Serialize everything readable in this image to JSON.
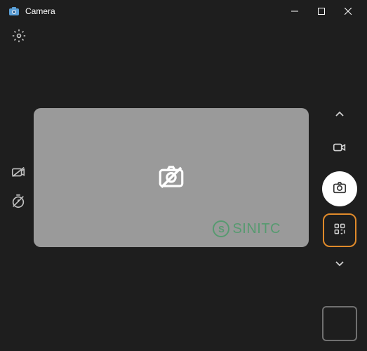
{
  "titlebar": {
    "app_name": "Camera"
  },
  "watermark": {
    "symbol": "S",
    "text": "SINITC"
  },
  "icons": {
    "settings": "gear",
    "no_camera": "no-camera",
    "switch_camera": "switch-camera-off",
    "timer": "timer-off",
    "video": "video",
    "photo": "photo",
    "qr": "qr-scan"
  },
  "colors": {
    "background": "#1e1e1e",
    "viewport": "#9a9a9a",
    "accent": "#e08a2a",
    "watermark": "#3b9b5f"
  }
}
